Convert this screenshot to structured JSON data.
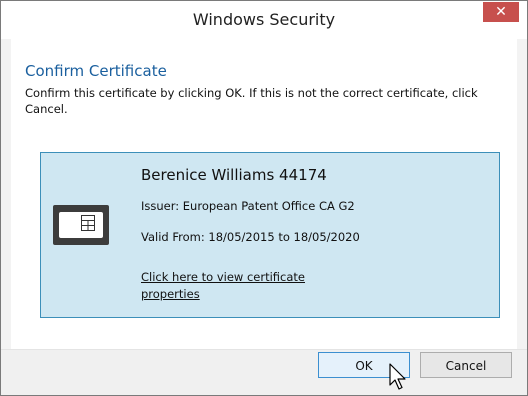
{
  "window": {
    "title": "Windows Security",
    "close_symbol": "✕"
  },
  "heading": "Confirm Certificate",
  "description": "Confirm this certificate by clicking OK. If this is not the correct certificate, click Cancel.",
  "certificate": {
    "name": "Berenice Williams 44174",
    "issuer": "Issuer: European Patent Office CA G2",
    "valid": "Valid From: 18/05/2015 to 18/05/2020",
    "link": "Click here to view certificate properties",
    "icon": "smart-card-icon"
  },
  "buttons": {
    "ok": "OK",
    "cancel": "Cancel"
  },
  "colors": {
    "heading": "#1a5f9e",
    "cert_background": "#cfe7f2",
    "cert_border": "#3c8fb9",
    "close_button": "#c7504d"
  }
}
